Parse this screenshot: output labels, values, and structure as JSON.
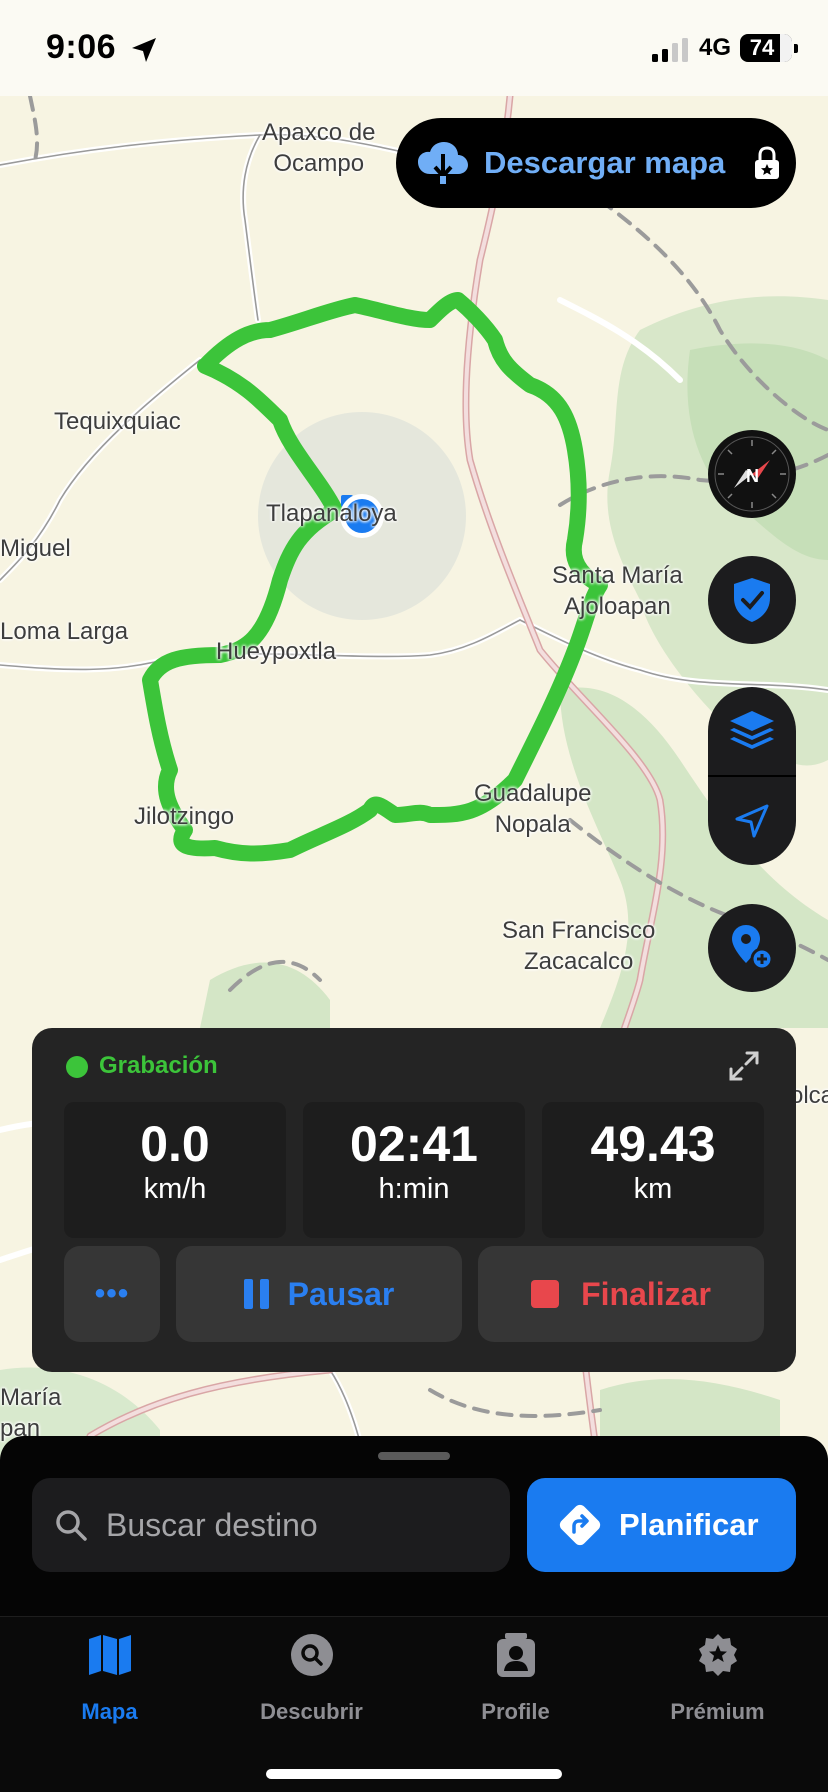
{
  "status_bar": {
    "time": "9:06",
    "network": "4G",
    "battery": "74"
  },
  "map": {
    "download_button_label": "Descargar mapa",
    "places": {
      "apaxco": "Apaxco de\nOcampo",
      "tequixquiac": "Tequixquiac",
      "tlapanaloya": "Tlapanaloya",
      "miguel": "Miguel",
      "loma_larga": "Loma Larga",
      "hueypoxtla": "Hueypoxtla",
      "santa_maria": "Santa María\nAjoloapan",
      "jilotzingo": "Jilotzingo",
      "guadalupe": "Guadalupe\nNopala",
      "san_francisco": "San Francisco\nZacacalco",
      "maria_edge": "María",
      "pan_edge": "pan",
      "olca_edge": "olca"
    },
    "route_color": "#3cc43a",
    "accent": "#1a7bf0",
    "right_controls": [
      "compass-icon",
      "shield-check-icon",
      "layers-icon",
      "navigation-arrow-icon",
      "add-pin-icon"
    ]
  },
  "recording": {
    "label": "Grabación",
    "stats": [
      {
        "value": "0.0",
        "unit": "km/h"
      },
      {
        "value": "02:41",
        "unit": "h:min"
      },
      {
        "value": "49.43",
        "unit": "km"
      }
    ],
    "more_label": "•••",
    "pause_label": "Pausar",
    "finish_label": "Finalizar"
  },
  "sheet": {
    "search_placeholder": "Buscar destino",
    "plan_label": "Planificar"
  },
  "tabs": [
    {
      "label": "Mapa",
      "icon": "map-icon",
      "active": true
    },
    {
      "label": "Descubrir",
      "icon": "discover-icon",
      "active": false
    },
    {
      "label": "Profile",
      "icon": "profile-icon",
      "active": false
    },
    {
      "label": "Prémium",
      "icon": "premium-icon",
      "active": false
    }
  ]
}
